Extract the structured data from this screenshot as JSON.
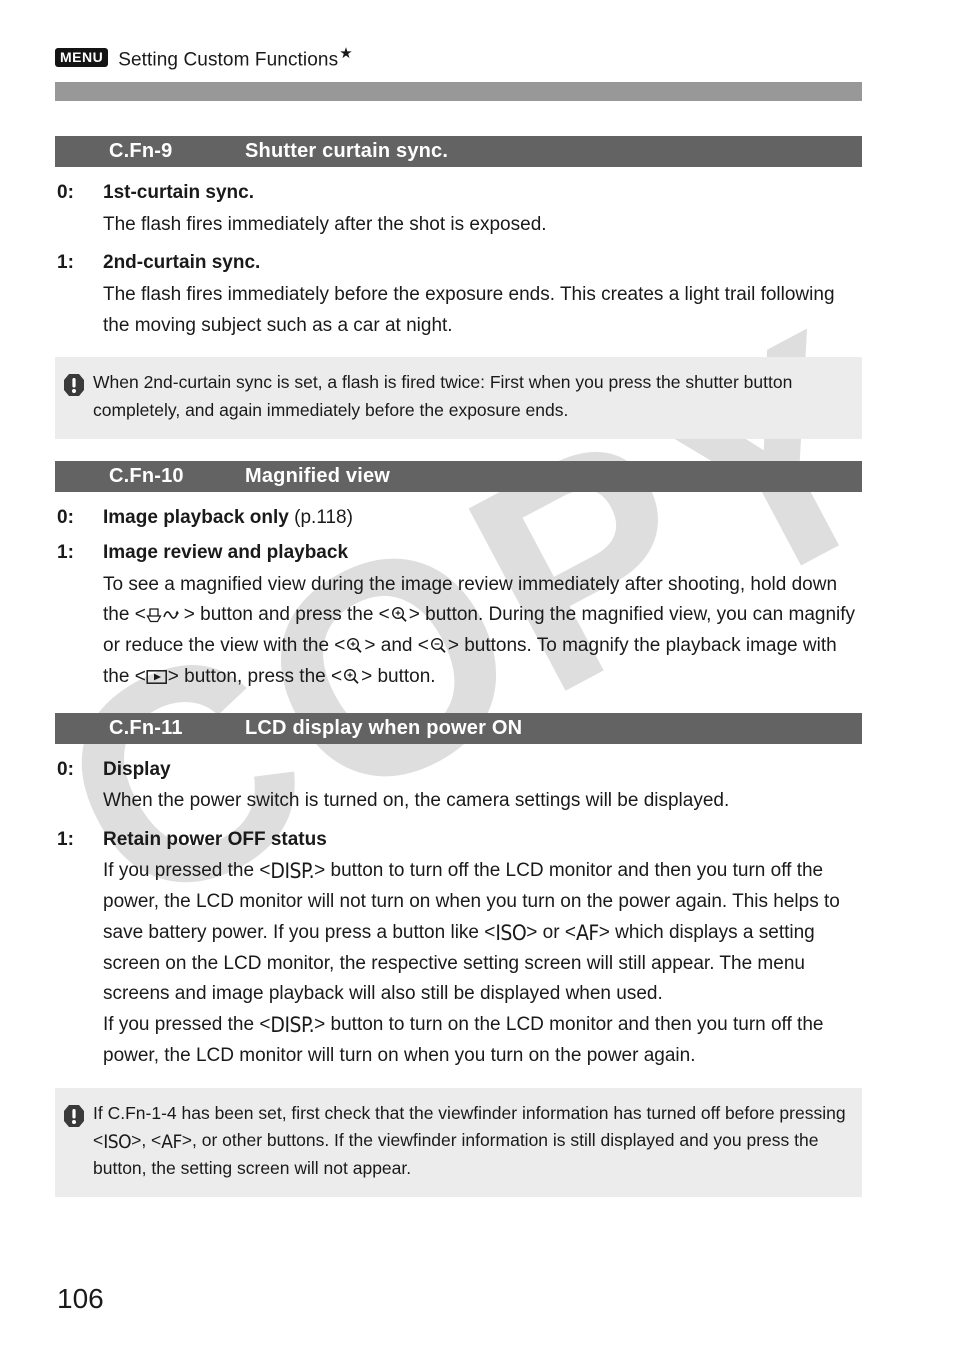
{
  "watermark": {
    "text": "COPY"
  },
  "header": {
    "menu_badge": "MENU",
    "title": "Setting Custom Functions",
    "star": "★"
  },
  "page_number": "106",
  "sections": [
    {
      "id": "C.Fn-9",
      "title": "Shutter curtain sync.",
      "options": [
        {
          "num": "0:",
          "label": "1st-curtain sync.",
          "body": "The flash fires immediately after the shot is exposed."
        },
        {
          "num": "1:",
          "label": "2nd-curtain sync.",
          "body": "The flash fires immediately before the exposure ends. This creates a light trail following the moving subject such as a car at night."
        }
      ],
      "note": {
        "icon": "caution-icon",
        "text": "When 2nd-curtain sync is set, a flash is fired twice: First when you press the shutter button completely, and again immediately before the exposure ends."
      }
    },
    {
      "id": "C.Fn-10",
      "title": "Magnified view",
      "options": [
        {
          "num": "0:",
          "label": "Image playback only",
          "label_suffix": "(p.118)",
          "body": ""
        },
        {
          "num": "1:",
          "label": "Image review and playback",
          "body_parts": {
            "p1": "To see a magnified view during the image review immediately after shooting, hold down the <",
            "p2": "> button and press the <",
            "p3": "> button. During the magnified view, you can magnify or reduce the view with the <",
            "p4": "> and <",
            "p5": "> buttons. To magnify the playback image with the <",
            "p6": "> button, press the <",
            "p7": "> button."
          }
        }
      ]
    },
    {
      "id": "C.Fn-11",
      "title": "LCD display when power ON",
      "options": [
        {
          "num": "0:",
          "label": "Display",
          "body": "When the power switch is turned on, the camera settings will be displayed."
        },
        {
          "num": "1:",
          "label": "Retain power OFF status",
          "body_parts": {
            "p1": "If you pressed the <",
            "disp1": "DISP.",
            "p2": "> button to turn off the LCD monitor and then you turn off the power, the LCD monitor will not turn on when you turn on the power again. This helps to save battery power. If you press a button like <",
            "iso1": "ISO",
            "p3": "> or <",
            "af1": "AF",
            "p4": "> which displays a setting screen on the LCD monitor, the respective setting screen will still appear. The menu screens and image playback will also still be displayed when used.",
            "p5": "If you pressed the <",
            "disp2": "DISP.",
            "p6": "> button to turn on the LCD monitor and then you turn off the power, the LCD monitor will turn on when you turn on the power again."
          }
        }
      ],
      "note": {
        "icon": "caution-icon",
        "text_parts": {
          "p1": "If C.Fn-1-4 has been set, first check that the viewfinder information has turned off before pressing <",
          "iso": "ISO",
          "p2": ">, <",
          "af": "AF",
          "p3": ">, or other buttons. If the viewfinder information is still displayed and you press the button, the setting screen will not appear."
        }
      }
    }
  ],
  "icons": {
    "print_share": "print-share-icon",
    "magnify_plus": "magnify-plus-icon",
    "magnify_minus": "magnify-minus-icon",
    "playback": "playback-icon",
    "caution": "caution-icon"
  },
  "colors": {
    "section_bar": "#636363",
    "header_rule": "#989898",
    "note_bg": "#ececec",
    "watermark": "#dedede",
    "text": "#1a1a1a"
  }
}
